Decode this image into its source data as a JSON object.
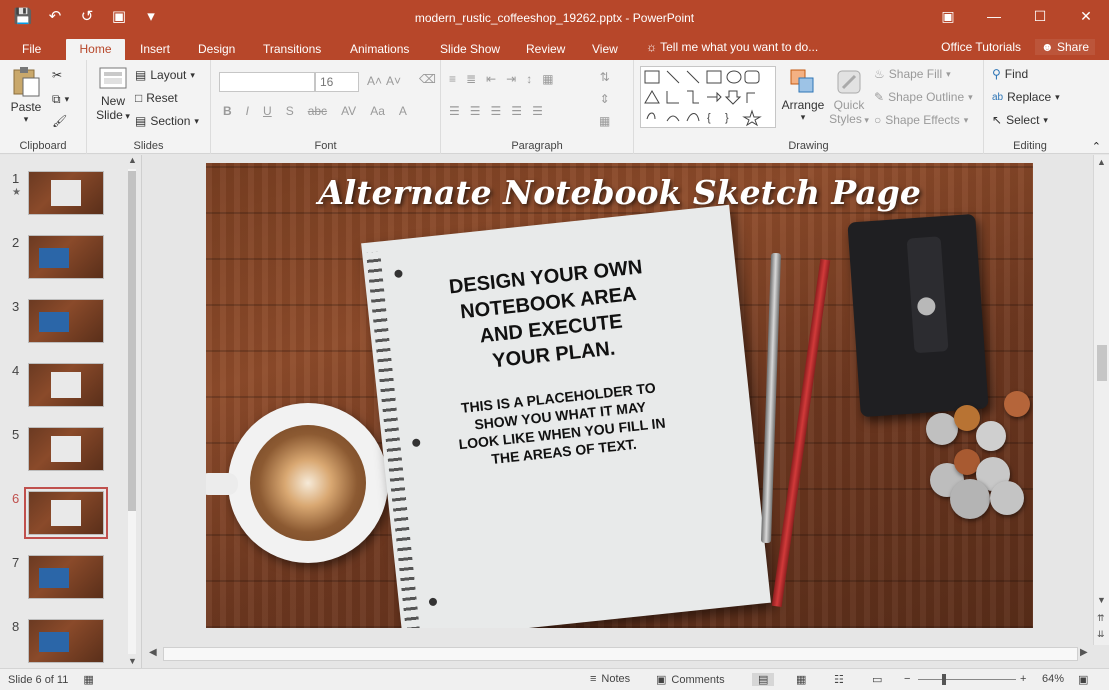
{
  "window": {
    "title": "modern_rustic_coffeeshop_19262.pptx - PowerPoint",
    "controls": [
      "restore-ribbon",
      "minimize",
      "maximize",
      "close"
    ]
  },
  "tabs": {
    "file": "File",
    "home": "Home",
    "insert": "Insert",
    "design": "Design",
    "transitions": "Transitions",
    "animations": "Animations",
    "slide_show": "Slide Show",
    "review": "Review",
    "view": "View",
    "tell_me": "Tell me what you want to do...",
    "office_tutorials": "Office Tutorials",
    "share": "Share"
  },
  "ribbon": {
    "clipboard": {
      "paste": "Paste",
      "label": "Clipboard"
    },
    "slides": {
      "new_slide_line1": "New",
      "new_slide_line2": "Slide",
      "layout": "Layout",
      "reset": "Reset",
      "section": "Section",
      "label": "Slides"
    },
    "font": {
      "size": "16",
      "label": "Font",
      "bold": "B",
      "italic": "I",
      "underline": "U",
      "shadow": "S",
      "strike": "abc",
      "spacing": "AV",
      "case": "Aa",
      "color": "A"
    },
    "paragraph": {
      "label": "Paragraph"
    },
    "drawing": {
      "arrange": "Arrange",
      "quick_styles_line1": "Quick",
      "quick_styles_line2": "Styles",
      "shape_fill": "Shape Fill",
      "shape_outline": "Shape Outline",
      "shape_effects": "Shape Effects",
      "label": "Drawing"
    },
    "editing": {
      "find": "Find",
      "replace": "Replace",
      "select": "Select",
      "label": "Editing"
    }
  },
  "thumbnails": [
    {
      "num": "1",
      "star": "★"
    },
    {
      "num": "2"
    },
    {
      "num": "3"
    },
    {
      "num": "4"
    },
    {
      "num": "5"
    },
    {
      "num": "6"
    },
    {
      "num": "7"
    },
    {
      "num": "8"
    }
  ],
  "slide": {
    "title": "Alternate Notebook Sketch Page",
    "heading_lines": [
      "DESIGN YOUR OWN",
      "NOTEBOOK AREA",
      "AND EXECUTE",
      "YOUR PLAN."
    ],
    "body_lines": [
      "THIS IS A PLACEHOLDER TO",
      "SHOW YOU WHAT IT MAY",
      "LOOK LIKE WHEN YOU FILL IN",
      "THE AREAS OF TEXT."
    ]
  },
  "status": {
    "slide_info": "Slide 6 of 11",
    "notes": "Notes",
    "comments": "Comments",
    "zoom": "64%"
  },
  "colors": {
    "accent": "#b7472a",
    "ribbon_bg": "#f3f3f3",
    "selected_thumb": "#c0504d"
  },
  "icons": [
    "save-icon",
    "undo-icon",
    "redo-icon",
    "present-icon",
    "customize-qat-icon",
    "paste-icon",
    "cut-icon",
    "copy-icon",
    "format-painter-icon",
    "find-icon",
    "replace-icon",
    "select-icon",
    "notes-icon",
    "comments-icon",
    "normal-view-icon",
    "slide-sorter-icon",
    "reading-view-icon",
    "slideshow-icon",
    "fit-icon"
  ]
}
